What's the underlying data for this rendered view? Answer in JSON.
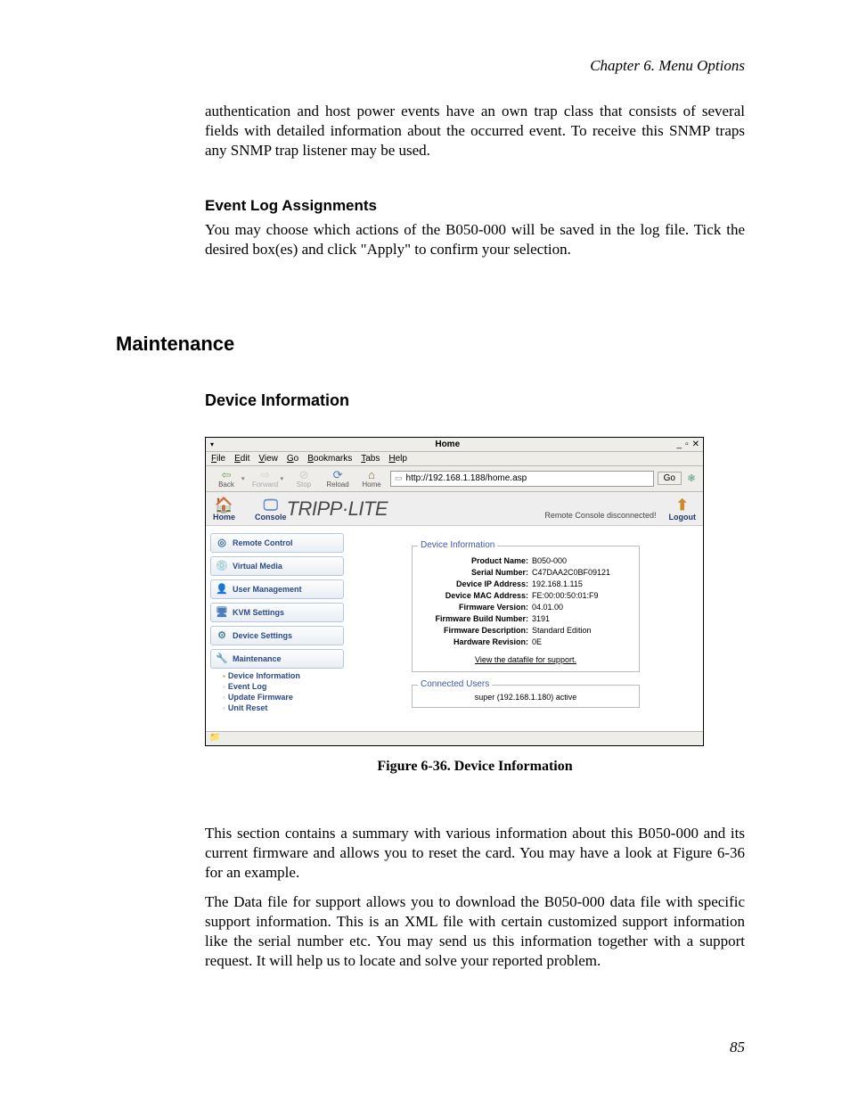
{
  "chapter_header": "Chapter 6. Menu Options",
  "intro_para": "authentication and host power events have an own trap class that consists of several fields with detailed information about the occurred event. To receive this SNMP traps any SNMP trap listener may be used.",
  "event_log_heading": "Event Log Assignments",
  "event_log_para": "You may choose which actions of the B050-000 will be saved in the log file. Tick the desired box(es) and click \"Apply\" to confirm your selection.",
  "maintenance_heading": "Maintenance",
  "device_info_heading": "Device Information",
  "figure_caption": "Figure 6-36. Device Information",
  "para_after_1": "This section contains a summary with various information about this B050-000 and its current firmware and allows you to reset the card. You may have a look at Figure 6-36 for an example.",
  "para_after_2": "The Data file for support allows you to download the B050-000 data file with specific support information. This is an XML file with certain customized support information like the serial number etc. You may send us this information together with a support request. It will help us to locate and solve your reported problem.",
  "page_number": "85",
  "browser": {
    "window_title": "Home",
    "menubar": [
      "File",
      "Edit",
      "View",
      "Go",
      "Bookmarks",
      "Tabs",
      "Help"
    ],
    "toolbar": {
      "back": "Back",
      "forward": "Forward",
      "stop": "Stop",
      "reload": "Reload",
      "home": "Home",
      "go": "Go"
    },
    "url": "http://192.168.1.188/home.asp",
    "header": {
      "home": "Home",
      "console": "Console",
      "brand": "TRIPP·LITE",
      "status": "Remote Console disconnected!",
      "logout": "Logout"
    },
    "sidebar": {
      "items": [
        "Remote Control",
        "Virtual Media",
        "User Management",
        "KVM Settings",
        "Device Settings",
        "Maintenance"
      ],
      "sub": [
        "Device Information",
        "Event Log",
        "Update Firmware",
        "Unit Reset"
      ]
    },
    "device_info": {
      "legend": "Device Information",
      "rows": [
        {
          "lbl": "Product Name:",
          "val": "B050-000"
        },
        {
          "lbl": "Serial Number:",
          "val": "C47DAA2C0BF09121"
        },
        {
          "lbl": "Device IP Address:",
          "val": "192.168.1.115"
        },
        {
          "lbl": "Device MAC Address:",
          "val": "FE:00:00:50:01:F9"
        },
        {
          "lbl": "Firmware Version:",
          "val": "04.01.00"
        },
        {
          "lbl": "Firmware Build Number:",
          "val": "3191"
        },
        {
          "lbl": "Firmware Description:",
          "val": "Standard Edition"
        },
        {
          "lbl": "Hardware Revision:",
          "val": "0E"
        }
      ],
      "support_link": "View the datafile for support."
    },
    "connected_users": {
      "legend": "Connected Users",
      "row": "super (192.168.1.180)  active"
    }
  }
}
